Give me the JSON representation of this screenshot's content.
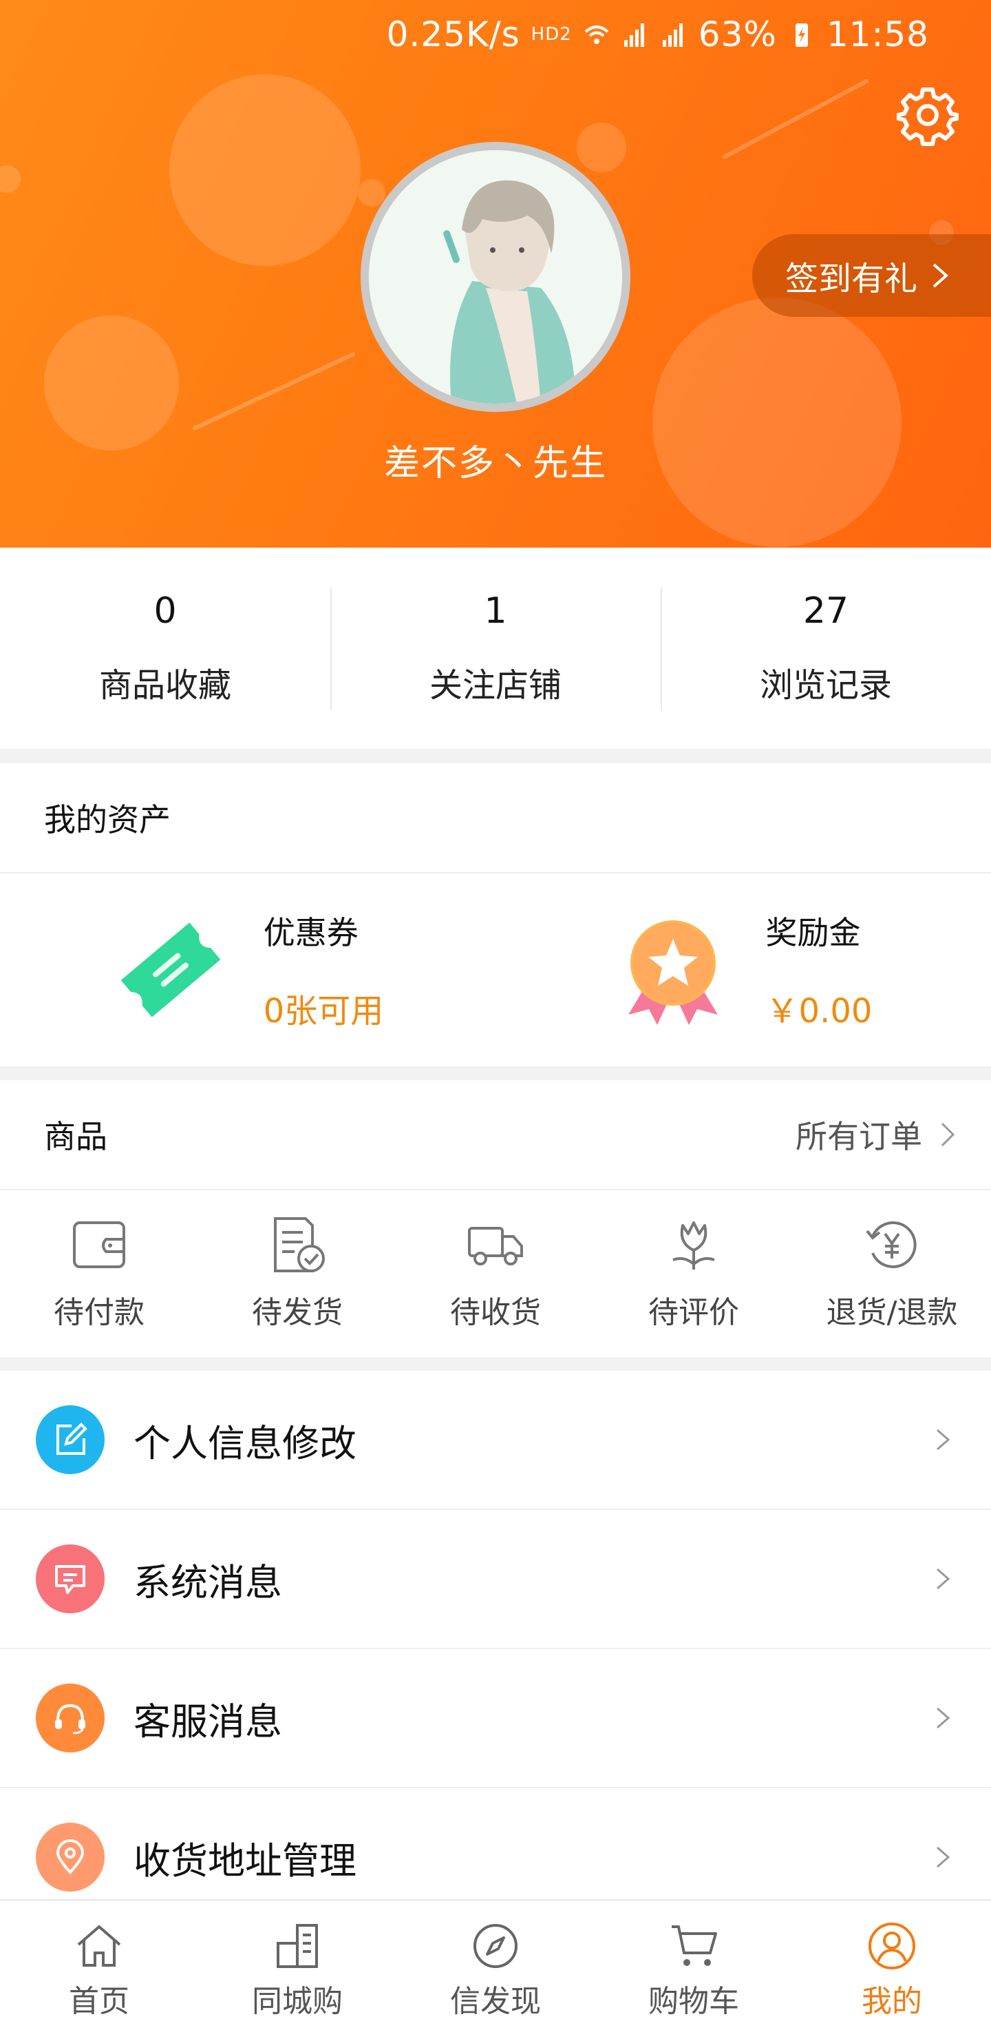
{
  "status_bar": {
    "speed": "0.25K/s",
    "hd": "HD2",
    "battery": "63%",
    "time": "11:58"
  },
  "profile": {
    "username": "差不多丶先生",
    "signin_label": "签到有礼"
  },
  "stats": [
    {
      "value": "0",
      "label": "商品收藏"
    },
    {
      "value": "1",
      "label": "关注店铺"
    },
    {
      "value": "27",
      "label": "浏览记录"
    }
  ],
  "assets": {
    "title": "我的资产",
    "items": [
      {
        "name": "优惠券",
        "value": "0张可用",
        "icon": "coupon-icon"
      },
      {
        "name": "奖励金",
        "value": "￥0.00",
        "icon": "reward-medal-icon"
      }
    ]
  },
  "orders": {
    "title": "商品",
    "all_label": "所有订单",
    "items": [
      {
        "label": "待付款",
        "icon": "wallet-icon"
      },
      {
        "label": "待发货",
        "icon": "document-check-icon"
      },
      {
        "label": "待收货",
        "icon": "truck-icon"
      },
      {
        "label": "待评价",
        "icon": "flower-icon"
      },
      {
        "label": "退货/退款",
        "icon": "refund-yuan-icon"
      }
    ]
  },
  "menu": [
    {
      "label": "个人信息修改",
      "icon": "edit-icon",
      "color": "#1fb6ef"
    },
    {
      "label": "系统消息",
      "icon": "message-icon",
      "color": "#f8727a"
    },
    {
      "label": "客服消息",
      "icon": "headset-icon",
      "color": "#ff8a3a"
    },
    {
      "label": "收货地址管理",
      "icon": "location-pin-icon",
      "color": "#ff9a6e"
    }
  ],
  "tabbar": [
    {
      "label": "首页",
      "icon": "home-icon"
    },
    {
      "label": "同城购",
      "icon": "city-buildings-icon"
    },
    {
      "label": "信发现",
      "icon": "compass-icon"
    },
    {
      "label": "购物车",
      "icon": "cart-icon"
    },
    {
      "label": "我的",
      "icon": "user-circle-icon",
      "active": true
    }
  ],
  "colors": {
    "accent": "#ff7a12",
    "price": "#f08a0d",
    "active_tab": "#f07c12"
  }
}
